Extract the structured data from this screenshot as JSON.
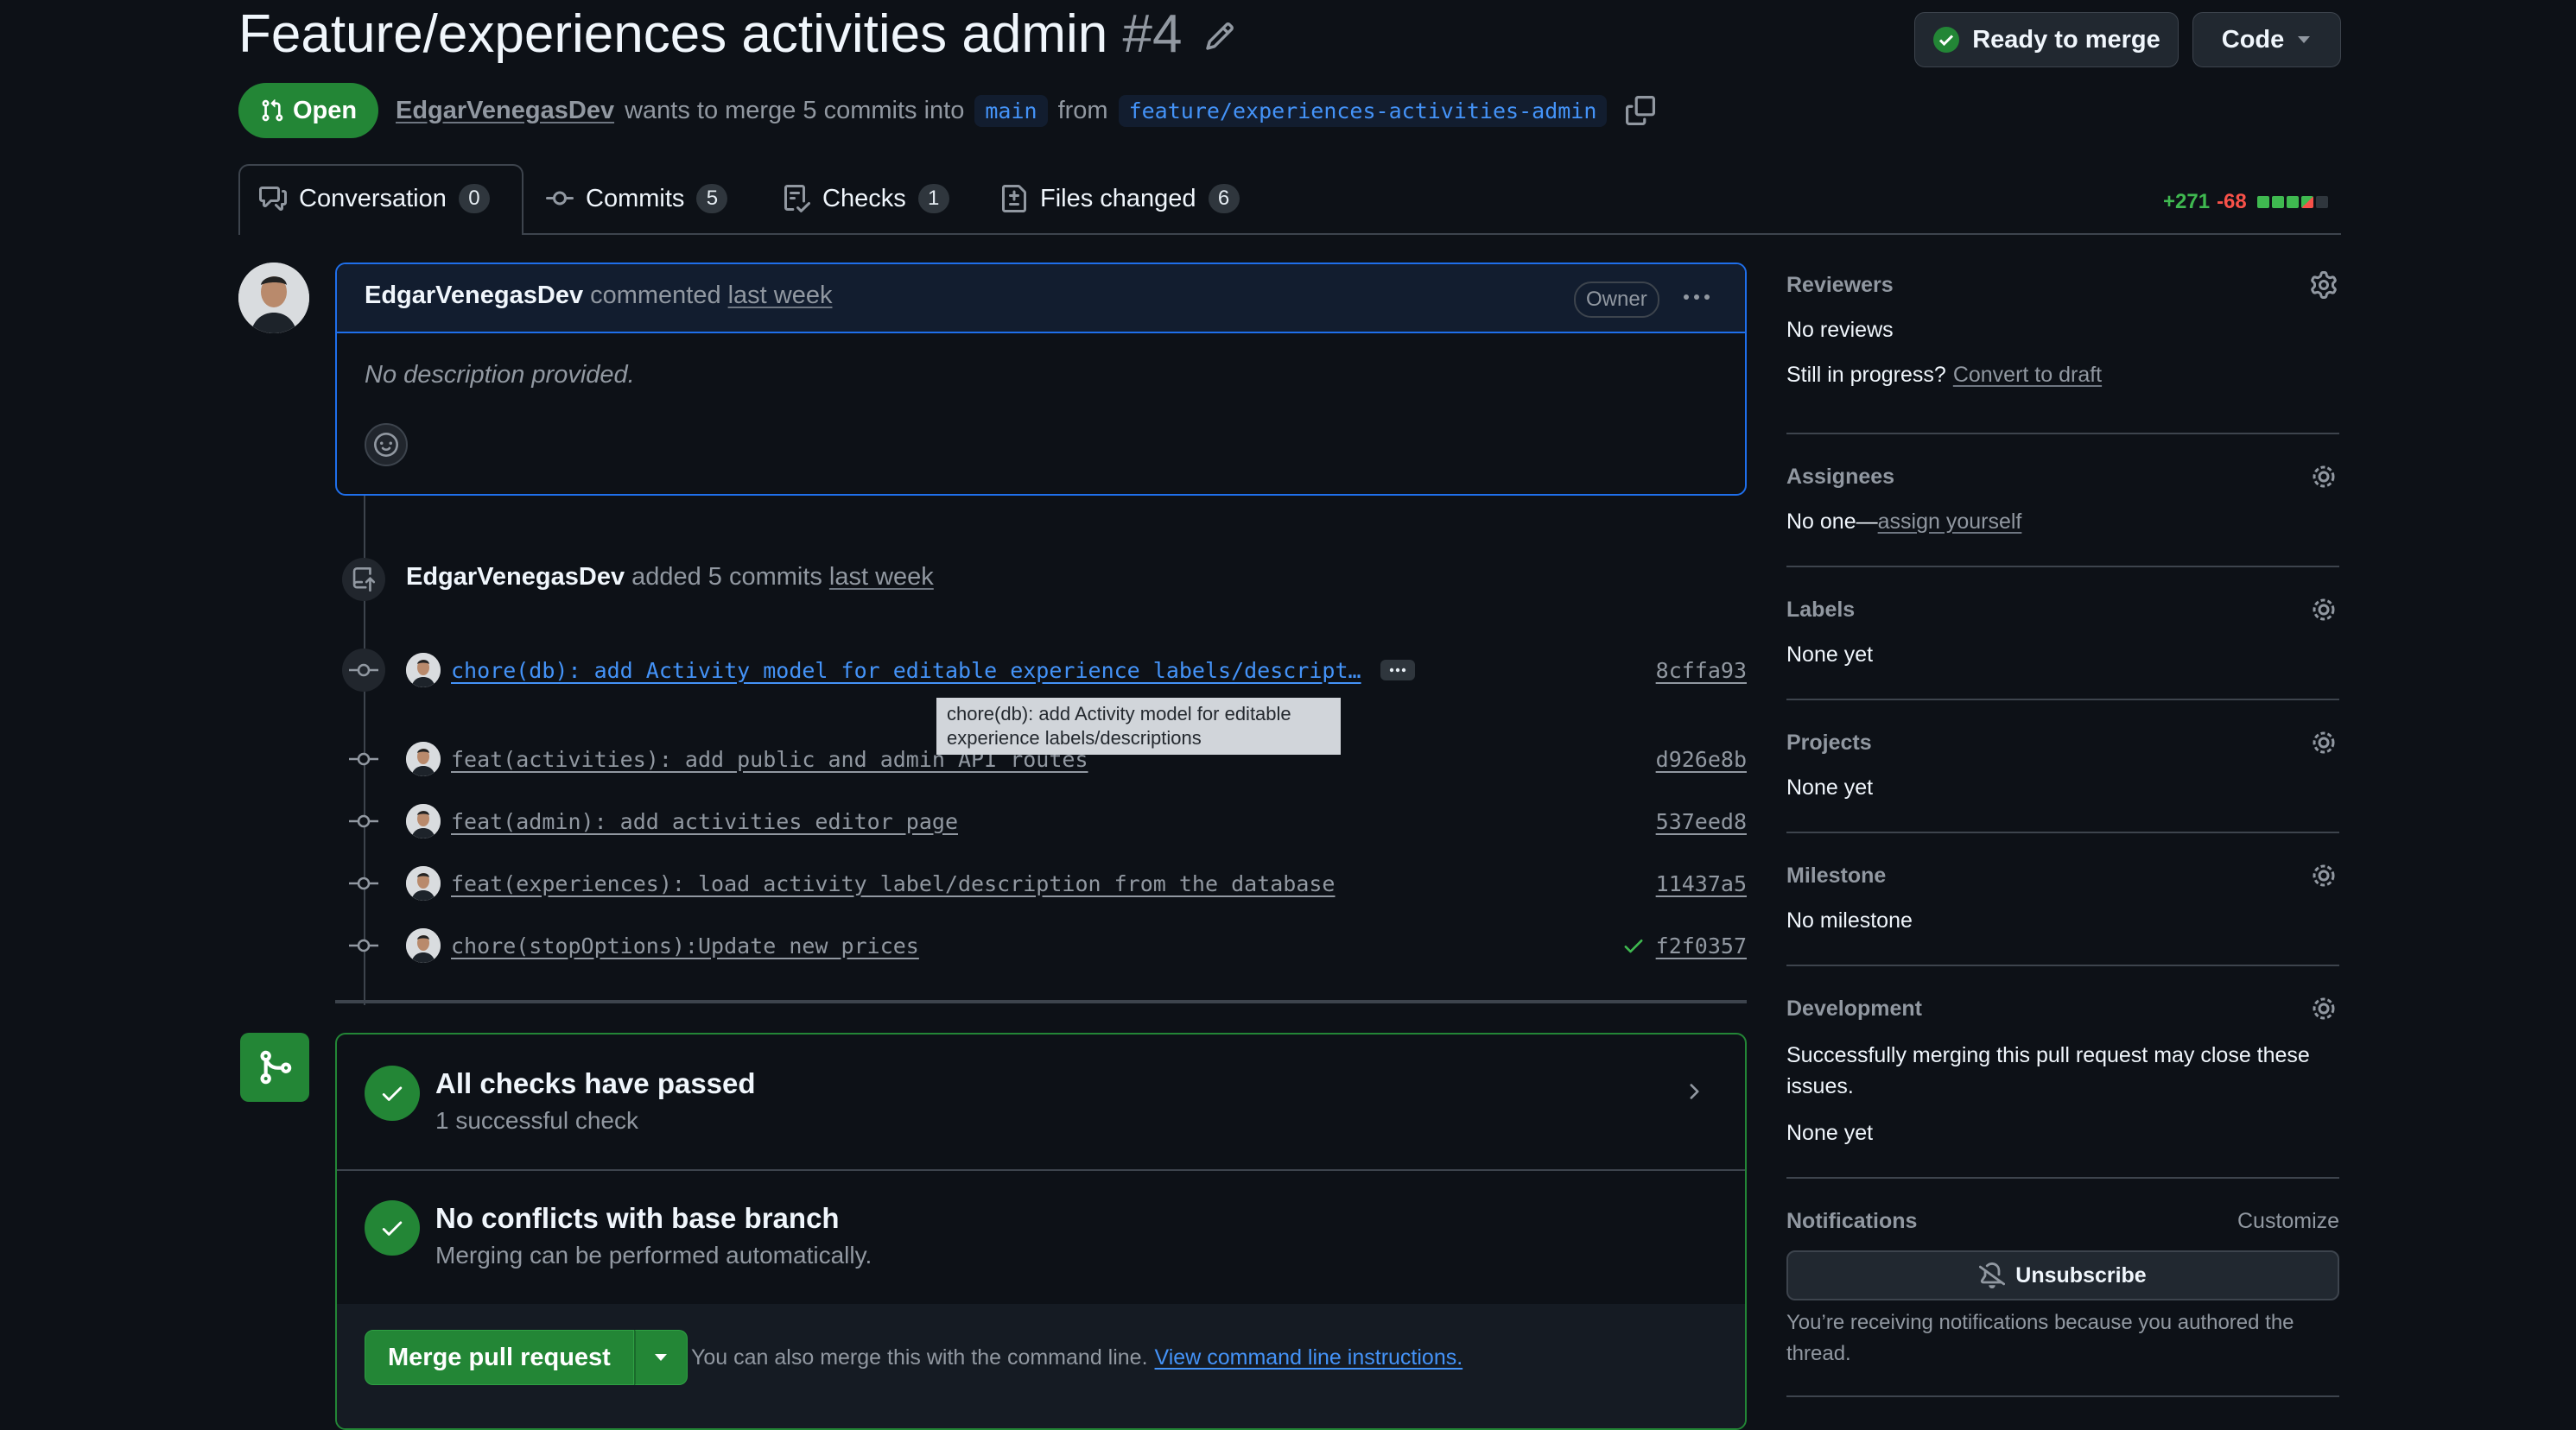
{
  "header": {
    "title": "Feature/experiences activities admin",
    "number": "#4",
    "ready_label": "Ready to merge",
    "code_label": "Code"
  },
  "meta": {
    "state": "Open",
    "author": "EdgarVenegasDev",
    "text_mid": "wants to merge 5 commits into",
    "base": "main",
    "text_from": "from",
    "head": "feature/experiences-activities-admin"
  },
  "tabs": [
    {
      "label": "Conversation",
      "count": "0"
    },
    {
      "label": "Commits",
      "count": "5"
    },
    {
      "label": "Checks",
      "count": "1"
    },
    {
      "label": "Files changed",
      "count": "6"
    }
  ],
  "diffstat": {
    "added": "+271",
    "removed": "-68"
  },
  "comment": {
    "author": "EdgarVenegasDev",
    "verb": "commented",
    "time": "last week",
    "badge": "Owner",
    "body": "No description provided."
  },
  "commits_event": {
    "author": "EdgarVenegasDev",
    "text": "added 5 commits",
    "time": "last week"
  },
  "commits": [
    {
      "message": "chore(db): add Activity model for editable experience labels/descript…",
      "sha": "8cffa93"
    },
    {
      "message": "feat(activities): add public and admin API routes",
      "sha": "d926e8b"
    },
    {
      "message": "feat(admin): add activities editor page",
      "sha": "537eed8"
    },
    {
      "message": "feat(experiences): load activity label/description from the database",
      "sha": "11437a5"
    },
    {
      "message": "chore(stopOptions):Update new prices",
      "sha": "f2f0357"
    }
  ],
  "tooltip": {
    "line1": "chore(db): add Activity model for editable",
    "line2": "experience labels/descriptions"
  },
  "merge": {
    "checks_title": "All checks have passed",
    "checks_sub": "1 successful check",
    "conflicts_title": "No conflicts with base branch",
    "conflicts_sub": "Merging can be performed automatically.",
    "merge_button": "Merge pull request",
    "cli_text": "You can also merge this with the command line.",
    "cli_link": "View command line instructions."
  },
  "sidebar": {
    "reviewers": {
      "heading": "Reviewers",
      "value": "No reviews",
      "draft_q": "Still in progress?",
      "draft_link": "Convert to draft"
    },
    "assignees": {
      "heading": "Assignees",
      "value": "No one—",
      "link": "assign yourself"
    },
    "labels": {
      "heading": "Labels",
      "value": "None yet"
    },
    "projects": {
      "heading": "Projects",
      "value": "None yet"
    },
    "milestone": {
      "heading": "Milestone",
      "value": "No milestone"
    },
    "development": {
      "heading": "Development",
      "desc": "Successfully merging this pull request may close these issues.",
      "value": "None yet"
    },
    "notifications": {
      "heading": "Notifications",
      "customize": "Customize",
      "button": "Unsubscribe",
      "desc": "You’re receiving notifications because you authored the thread."
    }
  },
  "colors": {
    "accent": "#238636",
    "link": "#4493f8",
    "add": "#3fb950",
    "del": "#f85149"
  }
}
